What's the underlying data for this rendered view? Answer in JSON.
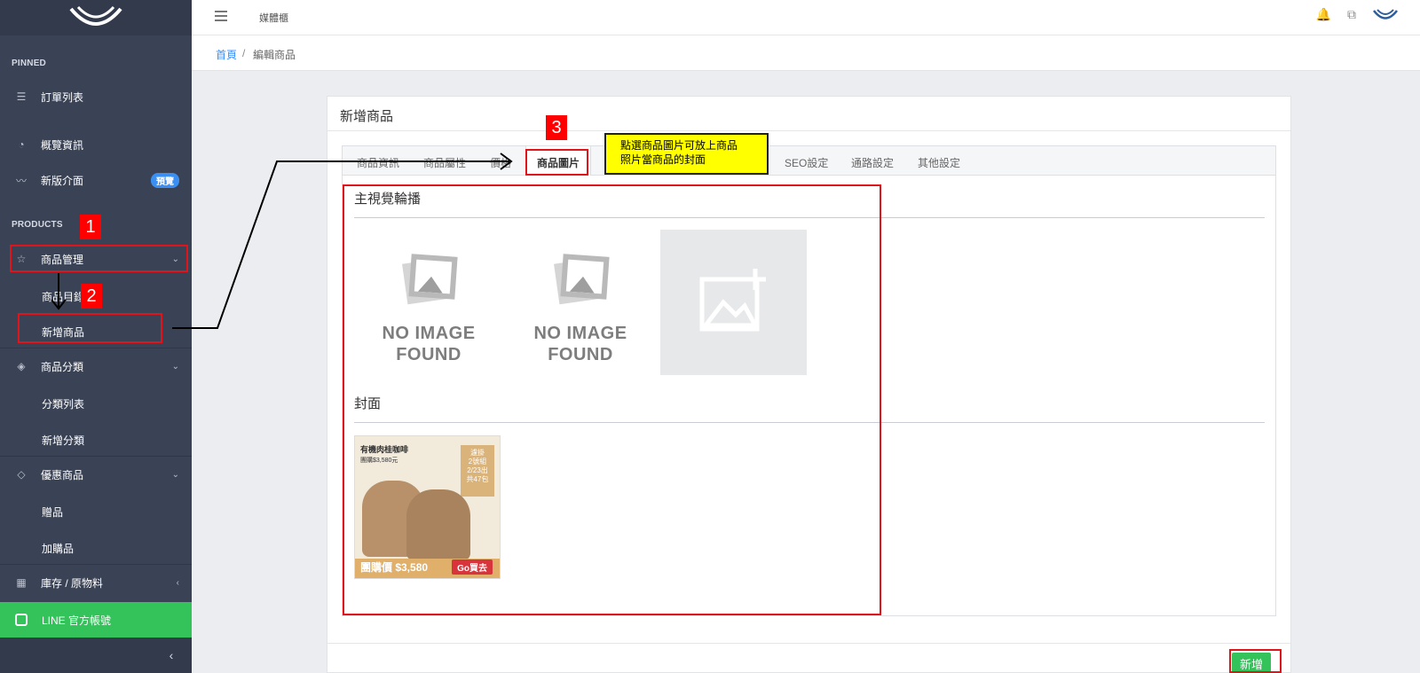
{
  "sidebar": {
    "sections": {
      "pinned": "PINNED",
      "products": "PRODUCTS"
    },
    "items": {
      "orders": "訂單列表",
      "overview": "概覽資訊",
      "new_ui": "新版介面",
      "new_ui_badge": "預覽",
      "product_mgmt": "商品管理",
      "product_list": "商品目錄",
      "add_product": "新增商品",
      "category": "商品分類",
      "category_list": "分類列表",
      "add_category": "新增分類",
      "promo": "優惠商品",
      "gift": "贈品",
      "addon": "加購品",
      "inventory": "庫存 / 原物料",
      "line": "LINE 官方帳號"
    },
    "icons": [
      "list-icon",
      "gauge-icon",
      "wave-logo-icon",
      "star-icon",
      "layers-icon",
      "diamond-icon",
      "boxes-icon",
      "line-icon",
      "chevron-left-icon"
    ]
  },
  "topbar": {
    "brand": "媒體櫃"
  },
  "breadcrumb": {
    "home": "首頁",
    "separator": "/",
    "current": "編輯商品"
  },
  "card": {
    "title": "新增商品",
    "tabs": [
      "商品資訊",
      "商品屬性",
      "價格",
      "商品圖片",
      "SEO設定",
      "通路設定",
      "其他設定"
    ],
    "active_tab": "商品圖片",
    "carousel_title": "主視覺輪播",
    "no_image_text_1": "NO IMAGE",
    "no_image_text_2": "FOUND",
    "cover_title": "封面",
    "cover_image": {
      "title": "有機肉桂咖啡",
      "subtitle": "團購$3,580元",
      "tag_line1": "濾掛",
      "tag_line2": "2號組",
      "tag_line3": "2/23出",
      "tag_line4": "共47包",
      "price": "團購價 $3,580",
      "cta": "Go買去"
    },
    "submit_label": "新增"
  },
  "annotations": {
    "step1": "1",
    "step2": "2",
    "step3": "3",
    "callout_line1": "點選商品圖片可放上商品",
    "callout_line2": "照片當商品的封面"
  },
  "colors": {
    "sidebar_bg": "#3a4255",
    "accent_green": "#33c35a",
    "accent_blue": "#3b8ff3",
    "annotation_red": "#e0151b",
    "callout_yellow": "#ffff00"
  }
}
